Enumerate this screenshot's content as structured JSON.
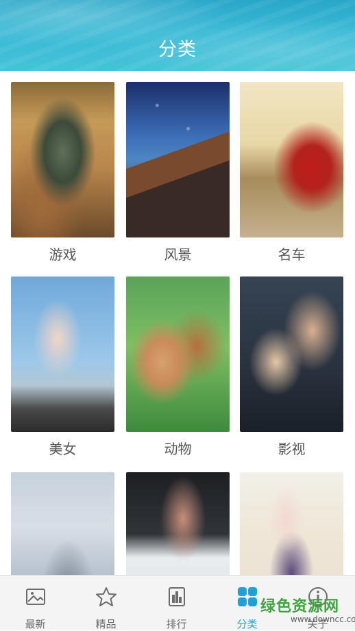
{
  "header": {
    "title": "分类"
  },
  "categories": [
    {
      "label": "游戏",
      "image": "robot-mech-artwork"
    },
    {
      "label": "风景",
      "image": "starry-sky-canyon"
    },
    {
      "label": "名车",
      "image": "red-sports-car"
    },
    {
      "label": "美女",
      "image": "woman-on-motorcycle"
    },
    {
      "label": "动物",
      "image": "poodle-puppies"
    },
    {
      "label": "影视",
      "image": "movie-couple"
    },
    {
      "label": "",
      "image": "vintage-airplane"
    },
    {
      "label": "",
      "image": "soccer-player"
    },
    {
      "label": "",
      "image": "anime-girl"
    }
  ],
  "tabbar": {
    "items": [
      {
        "label": "最新",
        "icon": "image-icon"
      },
      {
        "label": "精品",
        "icon": "star-icon"
      },
      {
        "label": "排行",
        "icon": "ranking-icon"
      },
      {
        "label": "分类",
        "icon": "category-grid-icon",
        "active": true
      },
      {
        "label": "关于",
        "icon": "info-icon"
      }
    ],
    "active_color": "#1aa3d6",
    "inactive_color": "#6b6b6b"
  },
  "watermark": {
    "text": "绿色资源网",
    "domain": "www.downcc.com"
  }
}
